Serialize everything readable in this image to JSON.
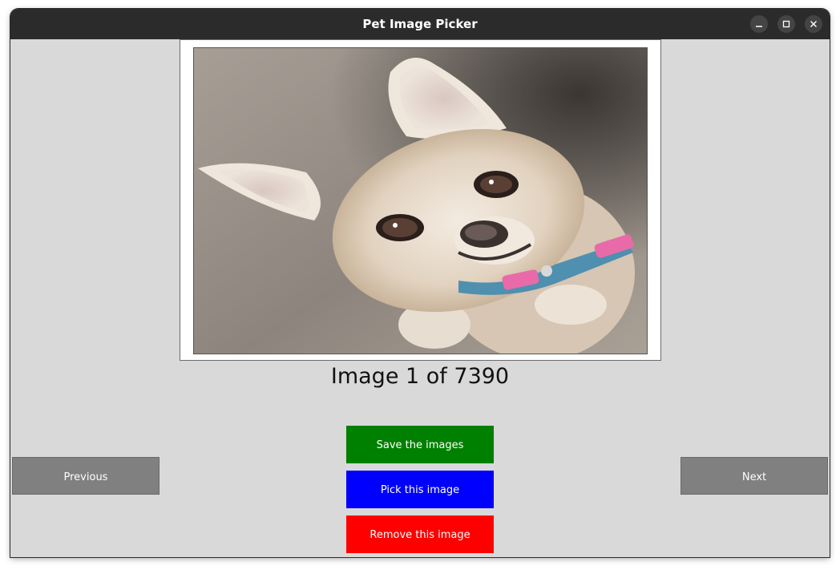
{
  "window": {
    "title": "Pet Image Picker",
    "controls": {
      "minimize_icon": "minimize-icon",
      "maximize_icon": "maximize-icon",
      "close_icon": "close-icon"
    }
  },
  "viewer": {
    "counter_text": "Image 1 of 7390"
  },
  "buttons": {
    "previous": "Previous",
    "next": "Next",
    "save": "Save the images",
    "pick": "Pick this image",
    "remove": "Remove this image"
  },
  "colors": {
    "save": "#008000",
    "pick": "#0000ff",
    "remove": "#ff0000",
    "nav": "#808080",
    "background": "#d9d9d9",
    "titlebar": "#2b2b2b"
  }
}
